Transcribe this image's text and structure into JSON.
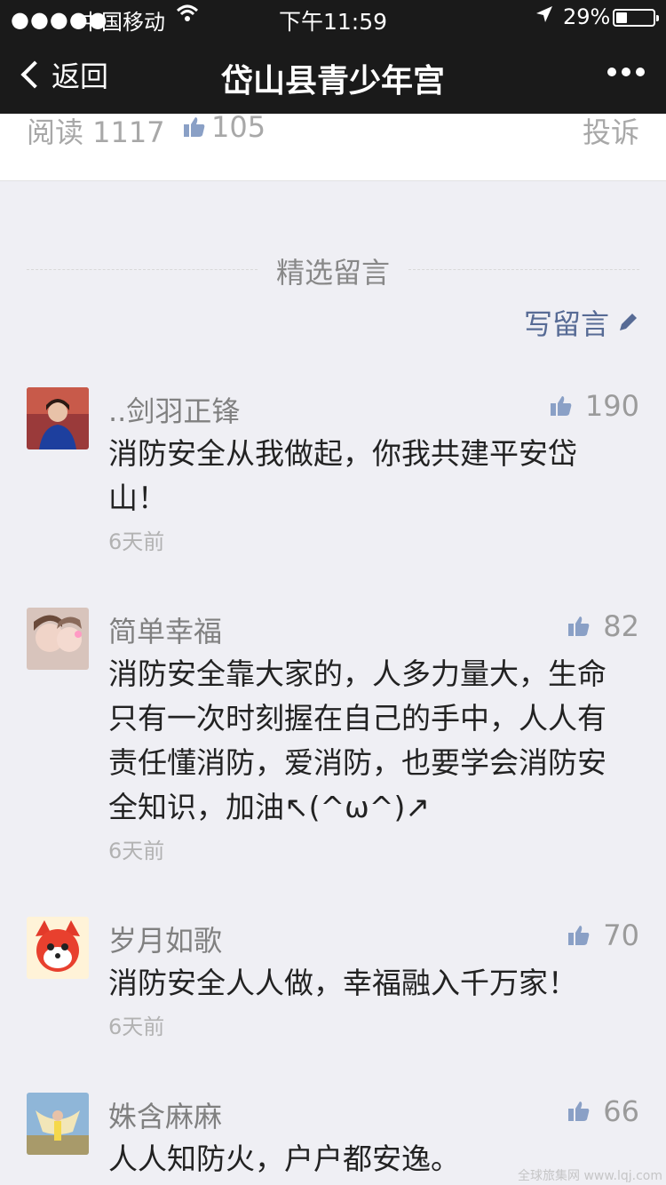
{
  "status_bar": {
    "carrier": "中国移动",
    "time": "下午11:59",
    "battery_percent": "29%",
    "battery_level": 0.29,
    "signal_icon": "signal-dots-icon",
    "wifi_icon": "wifi-icon",
    "location_icon": "location-arrow-icon"
  },
  "nav": {
    "back_label": "返回",
    "title": "岱山县青少年宫",
    "more_icon": "more-dots-icon"
  },
  "stats": {
    "read_label": "阅读 1117",
    "like_count": "105",
    "report_label": "投诉"
  },
  "comments_section": {
    "title": "精选留言",
    "write_label": "写留言"
  },
  "comments": [
    {
      "author": "..剑羽正锋",
      "likes": "190",
      "text": "消防安全从我做起，你我共建平安岱山！",
      "time": "6天前"
    },
    {
      "author": "简单幸福",
      "likes": "82",
      "text": "消防安全靠大家的，人多力量大，生命只有一次时刻握在自己的手中，人人有责任懂消防，爱消防，也要学会消防安全知识，加油↖(^ω^)↗",
      "time": "6天前"
    },
    {
      "author": "岁月如歌",
      "likes": "70",
      "text": "消防安全人人做，幸福融入千万家！",
      "time": "6天前"
    },
    {
      "author": "姝含麻麻",
      "likes": "66",
      "text": "人人知防火，户户都安逸。",
      "time": ""
    }
  ],
  "colors": {
    "bar_background": "#1a1a1a",
    "page_background": "#efeff4",
    "link_blue": "#576b95",
    "like_blue": "#8aa0c6",
    "secondary_text": "#808080"
  },
  "watermark": "全球旅集网 www.lqj.com"
}
